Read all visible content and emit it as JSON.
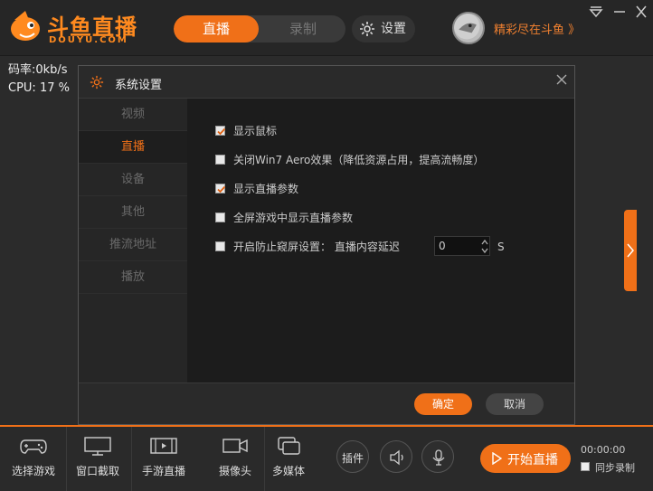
{
  "app": {
    "brand": "斗鱼直播",
    "brand_sub": "DOUYU.COM"
  },
  "header": {
    "tabs": [
      {
        "label": "直播",
        "active": true
      },
      {
        "label": "录制",
        "active": false
      }
    ],
    "settings_label": "设置",
    "promo_text": "精彩尽在斗鱼 》"
  },
  "stats": {
    "bitrate": "码率:0kb/s",
    "cpu": "CPU: 17 %"
  },
  "dialog": {
    "title": "系统设置",
    "sidebar": [
      {
        "label": "视频",
        "active": false
      },
      {
        "label": "直播",
        "active": true
      },
      {
        "label": "设备",
        "active": false
      },
      {
        "label": "其他",
        "active": false
      },
      {
        "label": "推流地址",
        "active": false
      },
      {
        "label": "播放",
        "active": false
      }
    ],
    "options": [
      {
        "label": "显示鼠标",
        "checked": true
      },
      {
        "label": "关闭Win7  Aero效果（降低资源占用，提高流畅度）",
        "checked": false
      },
      {
        "label": "显示直播参数",
        "checked": true
      },
      {
        "label": "全屏游戏中显示直播参数",
        "checked": false
      },
      {
        "label": "开启防止窥屏设置：  直播内容延迟",
        "checked": false
      }
    ],
    "delay_value": "0",
    "delay_unit": "S",
    "ok_label": "确定",
    "cancel_label": "取消"
  },
  "bottom": {
    "tools": [
      {
        "label": "选择游戏",
        "icon": "gamepad-icon"
      },
      {
        "label": "窗口截取",
        "icon": "monitor-icon"
      },
      {
        "label": "手游直播",
        "icon": "film-icon"
      },
      {
        "label": "摄像头",
        "icon": "camera-icon"
      },
      {
        "label": "多媒体",
        "icon": "media-icon"
      }
    ],
    "plugin_label": "插件",
    "start_label": "开始直播",
    "timer": "00:00:00",
    "sync_label": "同步录制"
  },
  "colors": {
    "accent": "#f07018",
    "background": "#2b2b2b",
    "panel": "#1c1c1c"
  }
}
